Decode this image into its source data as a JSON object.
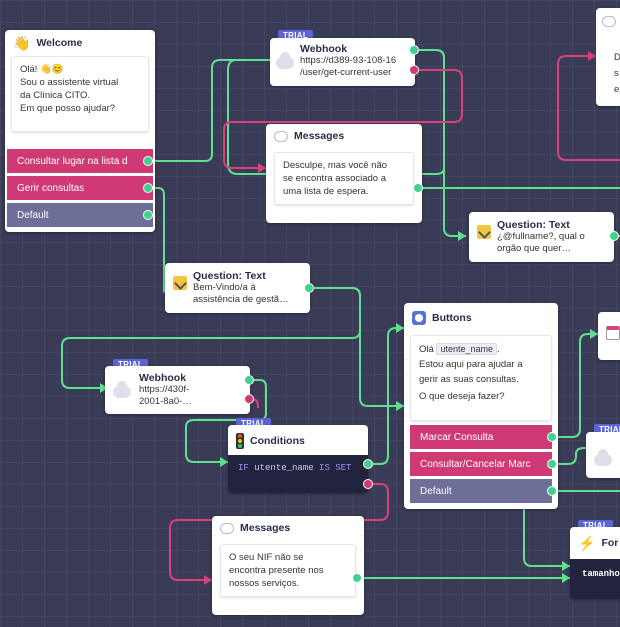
{
  "nodes": {
    "welcome": {
      "title": "Welcome",
      "icon": "waving-hand-icon",
      "message_line1": "Olá! 👋😊",
      "message_line2": "Sou o assistente virtual",
      "message_line3": "da Clínica CITO.",
      "message_line4": "Em que posso ajudar?",
      "buttons": [
        "Consultar lugar na lista d",
        "Gerir consultas",
        "Default"
      ]
    },
    "webhook1": {
      "chip": "TRIAL",
      "title": "Webhook",
      "url_line1": "https://d389-93-108-16",
      "url_line2": "/user/get-current-user"
    },
    "messages1": {
      "title": "Messages",
      "line1": "Desculpe, mas você não",
      "line2": "se encontra associado a",
      "line3": "uma lista de espera."
    },
    "question_right": {
      "title": "Question: Text",
      "line1": "¿@fullname?, qual o",
      "line2": "orgão que quer…"
    },
    "question_mid": {
      "title": "Question: Text",
      "line1": "Bem-Vindo/a à",
      "line2": "assistência de gestã…"
    },
    "buttons_node": {
      "title": "Buttons",
      "line1_prefix": "Olá",
      "variable": "utente_name",
      "line1_suffix": ".",
      "line2": "Estou aqui para ajudar a",
      "line3": "gerir as suas consultas.",
      "line4": "O que deseja fazer?",
      "buttons": [
        "Marcar Consulta",
        "Consultar/Cancelar Marc",
        "Default"
      ]
    },
    "webhook2": {
      "chip": "TRIAL",
      "title": "Webhook",
      "url_line1": "https://430f-",
      "url_line2": "2001-8a0-…"
    },
    "conditions": {
      "chip": "TRIAL",
      "title": "Conditions",
      "keyword_if": "IF",
      "variable": "utente_name",
      "operator": "IS SET"
    },
    "messages2": {
      "title": "Messages",
      "line1": "O seu NIF não se",
      "line2": "encontra presente nos",
      "line3": "nossos serviços."
    },
    "partial_top_right": {
      "line1": "D",
      "line2": "s",
      "line3": "e"
    },
    "partial_formula": {
      "chip": "TRIAL",
      "title": "For",
      "code": "tamanho"
    },
    "partial_webhook_right": {
      "chip": "TRIAL"
    }
  },
  "colors": {
    "background": "#3a3c57",
    "edge_green": "#5fe08f",
    "edge_pink": "#d8417a",
    "button_pink": "#cf3a74",
    "button_default": "#6d6f98",
    "trial_chip": "#5b64d6"
  }
}
